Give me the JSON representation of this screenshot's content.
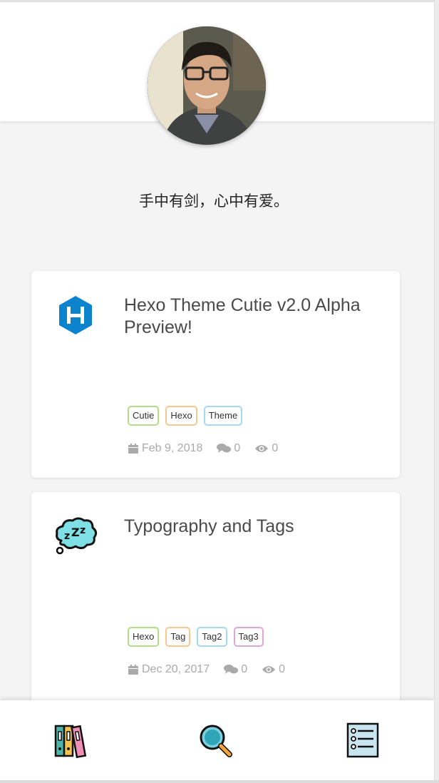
{
  "profile": {
    "motto": "手中有剑，心中有爱。"
  },
  "posts": [
    {
      "title": "Hexo Theme Cutie v2.0 Alpha Preview!",
      "icon": "hexo-logo-icon",
      "tags": [
        "Cutie",
        "Hexo",
        "Theme"
      ],
      "date": "Feb 9, 2018",
      "comments": "0",
      "views": "0"
    },
    {
      "title": "Typography and Tags",
      "icon": "thought-bubble-zzz-icon",
      "tags": [
        "Hexo",
        "Tag",
        "Tag2",
        "Tag3"
      ],
      "date": "Dec 20, 2017",
      "comments": "0",
      "views": "0"
    }
  ],
  "bottom_nav": {
    "items": [
      {
        "icon": "archive-binders-icon"
      },
      {
        "icon": "search-icon"
      },
      {
        "icon": "list-menu-icon"
      }
    ]
  },
  "colors": {
    "background": "#f4f4f4",
    "card": "#ffffff",
    "hexo_blue": "#0e83cd",
    "tag_green": "#b5dc8b",
    "tag_orange": "#f6c78e",
    "tag_blue": "#a5d8f3",
    "tag_pink": "#e0a6d8"
  }
}
